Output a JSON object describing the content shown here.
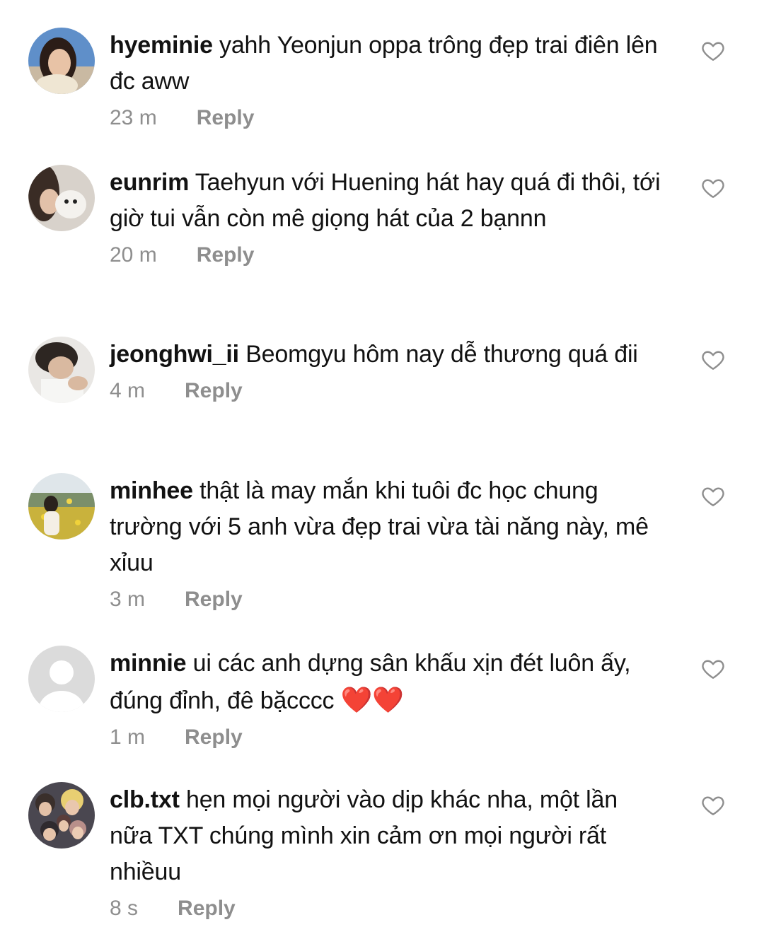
{
  "reply_label": "Reply",
  "comments": [
    {
      "username": "hyeminie",
      "text": "yahh Yeonjun oppa trông đẹp trai điên lên đc aww",
      "time": "23 m",
      "avatar": "profile-photo"
    },
    {
      "username": "eunrim",
      "text": "Taehyun với Huening hát hay quá đi thôi, tới giờ tui vẫn còn mê giọng hát của 2 bạnnn",
      "time": "20 m",
      "avatar": "profile-photo"
    },
    {
      "username": "jeonghwi_ii",
      "text": "Beomgyu hôm nay dễ thương quá đii",
      "time": "4 m",
      "avatar": "profile-photo"
    },
    {
      "username": "minhee",
      "text": "thật là may mắn khi tuôi đc học chung trường với 5 anh vừa đẹp trai vừa tài năng này, mê xỉuu",
      "time": "3 m",
      "avatar": "profile-photo"
    },
    {
      "username": "minnie",
      "text": "ui các anh dựng sân khấu xịn đét luôn ấy, đúng đỉnh, đê bặcccc",
      "emoji": "❤️❤️",
      "time": "1 m",
      "avatar": "default-avatar"
    },
    {
      "username": "clb.txt",
      "text": "hẹn mọi người vào dịp khác nha, một lần nữa TXT chúng mình xin cảm ơn mọi người rất nhiềuu",
      "time": "8 s",
      "avatar": "profile-photo"
    }
  ],
  "icons": {
    "like": "heart-outline-icon"
  },
  "colors": {
    "text": "#121212",
    "muted": "#8e8e8e",
    "heart": "#e0202b"
  }
}
